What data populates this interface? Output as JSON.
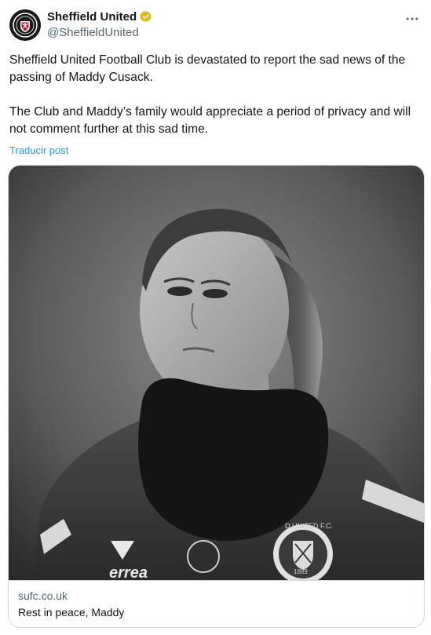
{
  "account": {
    "display_name": "Sheffield United",
    "handle": "@SheffieldUnited",
    "avatar_icon": "club-crest-icon",
    "verified_badge": "gold-verified-badge-icon",
    "verified_color": "#e2b719"
  },
  "menu": {
    "more_icon": "more-horizontal-icon"
  },
  "post": {
    "paragraph_1": "Sheffield United Football Club is devastated to report the sad news of the passing of Maddy Cusack.",
    "paragraph_2": "The Club and Maddy’s family would appreciate a period of privacy and will not comment further at this sad time.",
    "translate_label": "Traducir post"
  },
  "card": {
    "domain": "sufc.co.uk",
    "title": "Rest in peace, Maddy",
    "image": {
      "kit_brand": "errea",
      "crest_text": "D UNITED F.C.",
      "crest_year": "1889"
    }
  },
  "colors": {
    "text": "#0f1419",
    "secondary": "#536471",
    "link": "#1d9bf0",
    "border": "#cfd9de"
  }
}
